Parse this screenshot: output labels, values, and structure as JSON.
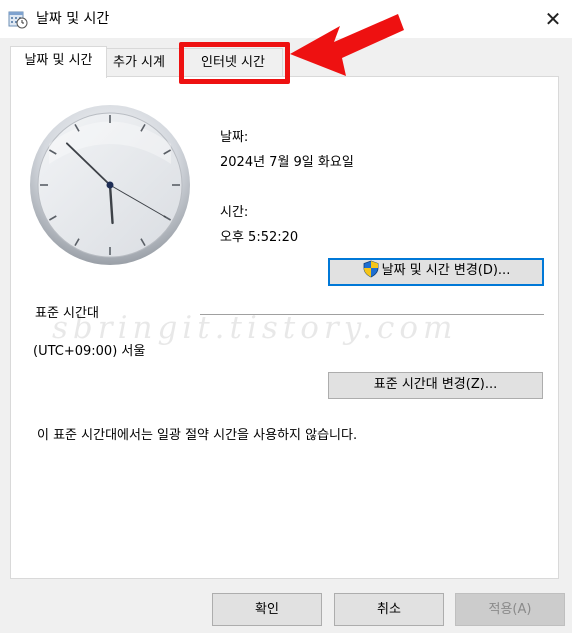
{
  "window": {
    "title": "날짜 및 시간",
    "close_symbol": "✕"
  },
  "tabs": [
    {
      "label": "날짜 및 시간",
      "selected": true
    },
    {
      "label": "추가 시계",
      "selected": false
    },
    {
      "label": "인터넷 시간",
      "selected": false
    }
  ],
  "datetime": {
    "date_label": "날짜:",
    "date_value": "2024년 7월 9일 화요일",
    "time_label": "시간:",
    "time_value": "오후 5:52:20",
    "change_button": "날짜 및 시간 변경(D)..."
  },
  "clock": {
    "hour": 5,
    "minute": 52,
    "second": 20
  },
  "timezone": {
    "header": "표준 시간대",
    "value": "(UTC+09:00) 서울",
    "change_button": "표준 시간대 변경(Z)...",
    "dst_note": "이 표준 시간대에서는 일광 절약 시간을 사용하지 않습니다."
  },
  "watermark": "sbringit.tistory.com",
  "buttons": {
    "ok": "확인",
    "cancel": "취소",
    "apply": "적용(A)"
  },
  "annotation": {
    "highlight_color": "#ee1111",
    "highlighted_tab": "인터넷 시간"
  },
  "icons": {
    "title": "datetime-control-panel-icon",
    "uac": "uac-shield-icon"
  }
}
